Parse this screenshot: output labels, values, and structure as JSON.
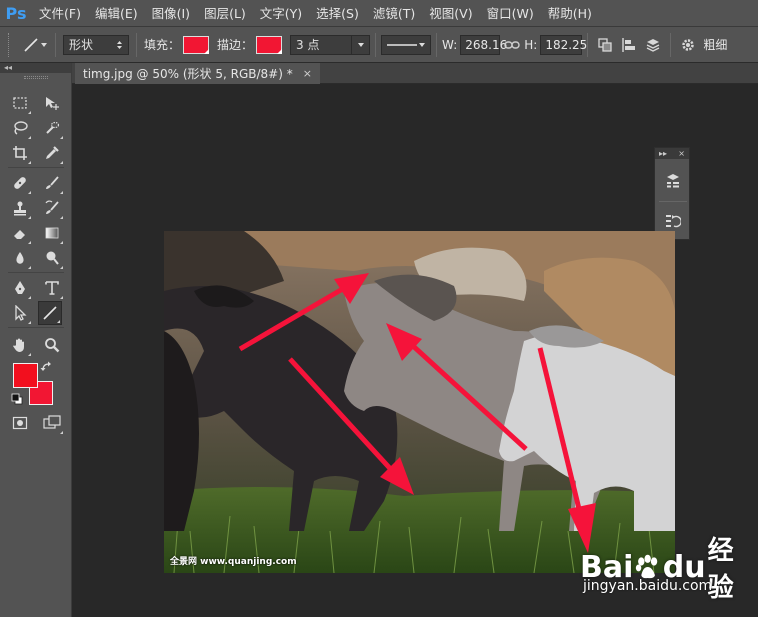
{
  "app": {
    "logo": "Ps"
  },
  "menu": [
    "文件(F)",
    "编辑(E)",
    "图像(I)",
    "图层(L)",
    "文字(Y)",
    "选择(S)",
    "滤镜(T)",
    "视图(V)",
    "窗口(W)",
    "帮助(H)"
  ],
  "options": {
    "mode_value": "形状",
    "fill_label": "填充：",
    "stroke_label": "描边：",
    "stroke_width_value": "3 点",
    "w_label": "W:",
    "w_value": "268.16",
    "h_label": "H:",
    "h_value": "182.25",
    "weight_label": "粗细",
    "fill_color": "#f21633",
    "stroke_color": "#f21633"
  },
  "document": {
    "tab_title": "timg.jpg @ 50% (形状 5, RGB/8#) *",
    "close_glyph": "×"
  },
  "toolbar": {
    "collapse_glyph": "◂◂",
    "foreground_color": "#f20f1e",
    "background_color": "#f21633"
  },
  "mini_panel": {
    "expand_glyph": "▸▸",
    "close_glyph": "×"
  },
  "canvas": {
    "watermark": "全景网  www.quanjing.com",
    "arrow_color": "#f5133a"
  },
  "baidu_watermark": {
    "brand_left": "Bai",
    "brand_right": "du",
    "brand_cn": "经验",
    "url": "jingyan.baidu.com"
  }
}
